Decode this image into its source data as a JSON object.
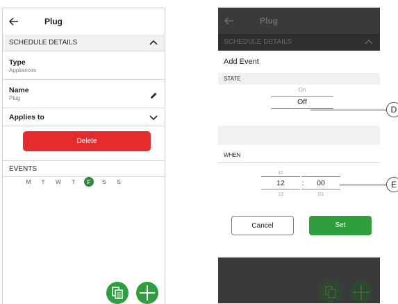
{
  "left_screen": {
    "title": "Plug",
    "schedule_details_label": "SCHEDULE DETAILS",
    "type": {
      "label": "Type",
      "value": "Appliances"
    },
    "name": {
      "label": "Name",
      "value": "Plug"
    },
    "applies_to_label": "Applies to",
    "delete_label": "Delete",
    "events_label": "EVENTS",
    "days": [
      "M",
      "T",
      "W",
      "T",
      "F",
      "S",
      "S"
    ],
    "selected_day": "F"
  },
  "right_screen": {
    "title": "Plug",
    "schedule_details_label": "SCHEDULE DETAILS",
    "add_event": {
      "title": "Add Event",
      "state_label": "STATE",
      "state_above": "On",
      "state_selected": "Off",
      "when_label": "WHEN",
      "hour_above": "11",
      "hour_selected": "12",
      "hour_below": "13",
      "separator": ":",
      "minute_selected": "00",
      "minute_below": "01",
      "cancel_label": "Cancel",
      "set_label": "Set"
    }
  },
  "callouts": {
    "d": "D",
    "e": "E"
  },
  "colors": {
    "accent_green": "#2e9e3e",
    "delete_red": "#e52c2c",
    "overlay_dark": "#3a3a3a"
  }
}
